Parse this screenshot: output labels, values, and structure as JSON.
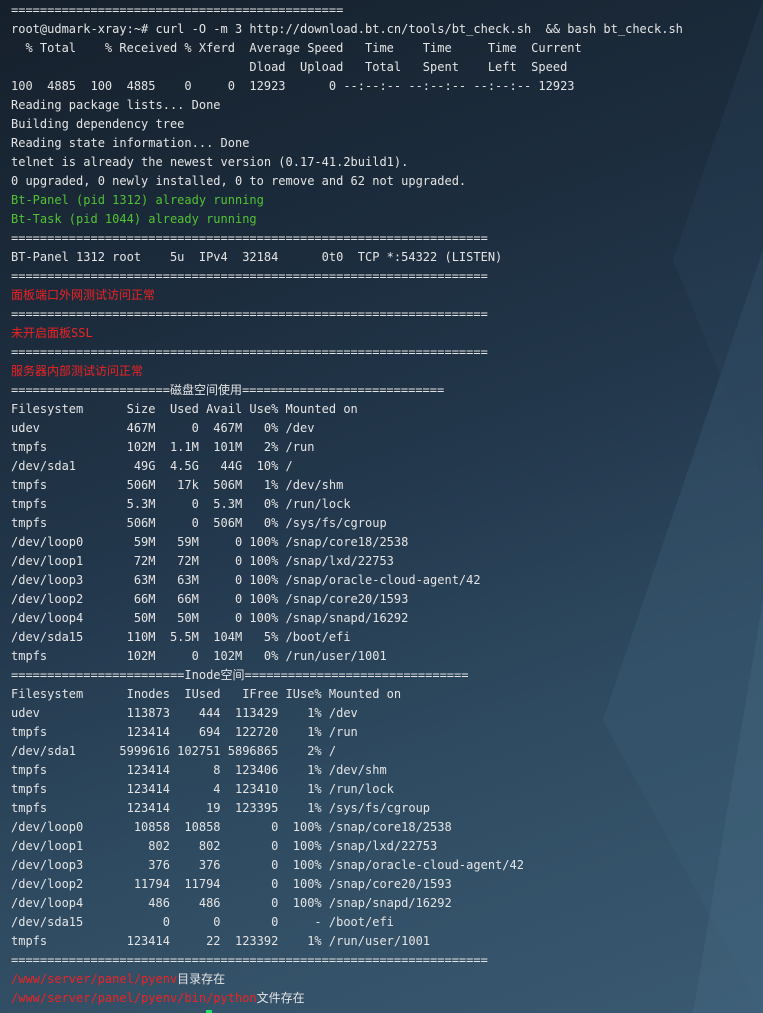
{
  "terminal": {
    "title": "",
    "lines": [
      {
        "text": "==============================================",
        "color": "white"
      },
      {
        "text": "root@udmark-xray:~# curl -O -m 3 http://download.bt.cn/tools/bt_check.sh  && bash bt_check.sh",
        "color": "white"
      },
      {
        "text": "  % Total    % Received % Xferd  Average Speed   Time    Time     Time  Current",
        "color": "white"
      },
      {
        "text": "                                 Dload  Upload   Total   Spent    Left  Speed",
        "color": "white"
      },
      {
        "text": "100  4885  100  4885    0     0  12923      0 --:--:-- --:--:-- --:--:-- 12923",
        "color": "white"
      },
      {
        "text": "Reading package lists... Done",
        "color": "white"
      },
      {
        "text": "Building dependency tree",
        "color": "white"
      },
      {
        "text": "Reading state information... Done",
        "color": "white"
      },
      {
        "text": "telnet is already the newest version (0.17-41.2build1).",
        "color": "white"
      },
      {
        "text": "0 upgraded, 0 newly installed, 0 to remove and 62 not upgraded.",
        "color": "white"
      },
      {
        "text": "Bt-Panel (pid 1312) already running",
        "color": "green"
      },
      {
        "text": "Bt-Task (pid 1044) already running",
        "color": "green"
      },
      {
        "text": "==================================================================",
        "color": "white"
      },
      {
        "text": "BT-Panel 1312 root    5u  IPv4  32184      0t0  TCP *:54322 (LISTEN)",
        "color": "white"
      },
      {
        "text": "==================================================================",
        "color": "white"
      },
      {
        "text": "面板端口外网测试访问正常",
        "color": "red"
      },
      {
        "text": "==================================================================",
        "color": "white"
      },
      {
        "text": "未开启面板SSL",
        "color": "red"
      },
      {
        "text": "==================================================================",
        "color": "white"
      },
      {
        "text": "服务器内部测试访问正常",
        "color": "red"
      },
      {
        "text": "======================磁盘空间使用============================",
        "color": "white"
      },
      {
        "text": "Filesystem      Size  Used Avail Use% Mounted on",
        "color": "white"
      },
      {
        "text": "udev            467M     0  467M   0% /dev",
        "color": "white"
      },
      {
        "text": "tmpfs           102M  1.1M  101M   2% /run",
        "color": "white"
      },
      {
        "text": "/dev/sda1        49G  4.5G   44G  10% /",
        "color": "white"
      },
      {
        "text": "tmpfs           506M   17k  506M   1% /dev/shm",
        "color": "white"
      },
      {
        "text": "tmpfs           5.3M     0  5.3M   0% /run/lock",
        "color": "white"
      },
      {
        "text": "tmpfs           506M     0  506M   0% /sys/fs/cgroup",
        "color": "white"
      },
      {
        "text": "/dev/loop0       59M   59M     0 100% /snap/core18/2538",
        "color": "white"
      },
      {
        "text": "/dev/loop1       72M   72M     0 100% /snap/lxd/22753",
        "color": "white"
      },
      {
        "text": "/dev/loop3       63M   63M     0 100% /snap/oracle-cloud-agent/42",
        "color": "white"
      },
      {
        "text": "/dev/loop2       66M   66M     0 100% /snap/core20/1593",
        "color": "white"
      },
      {
        "text": "/dev/loop4       50M   50M     0 100% /snap/snapd/16292",
        "color": "white"
      },
      {
        "text": "/dev/sda15      110M  5.5M  104M   5% /boot/efi",
        "color": "white"
      },
      {
        "text": "tmpfs           102M     0  102M   0% /run/user/1001",
        "color": "white"
      },
      {
        "text": "========================Inode空间===============================",
        "color": "white"
      },
      {
        "text": "Filesystem      Inodes  IUsed   IFree IUse% Mounted on",
        "color": "white"
      },
      {
        "text": "udev            113873    444  113429    1% /dev",
        "color": "white"
      },
      {
        "text": "tmpfs           123414    694  122720    1% /run",
        "color": "white"
      },
      {
        "text": "/dev/sda1      5999616 102751 5896865    2% /",
        "color": "white"
      },
      {
        "text": "tmpfs           123414      8  123406    1% /dev/shm",
        "color": "white"
      },
      {
        "text": "tmpfs           123414      4  123410    1% /run/lock",
        "color": "white"
      },
      {
        "text": "tmpfs           123414     19  123395    1% /sys/fs/cgroup",
        "color": "white"
      },
      {
        "text": "/dev/loop0       10858  10858       0  100% /snap/core18/2538",
        "color": "white"
      },
      {
        "text": "/dev/loop1         802    802       0  100% /snap/lxd/22753",
        "color": "white"
      },
      {
        "text": "/dev/loop3         376    376       0  100% /snap/oracle-cloud-agent/42",
        "color": "white"
      },
      {
        "text": "/dev/loop2       11794  11794       0  100% /snap/core20/1593",
        "color": "white"
      },
      {
        "text": "/dev/loop4         486    486       0  100% /snap/snapd/16292",
        "color": "white"
      },
      {
        "text": "/dev/sda15           0      0       0     - /boot/efi",
        "color": "white"
      },
      {
        "text": "tmpfs           123414     22  123392    1% /run/user/1001",
        "color": "white"
      },
      {
        "text": "==================================================================",
        "color": "white"
      },
      {
        "segments": [
          {
            "text": "/www/server/panel/pyenv",
            "color": "red"
          },
          {
            "text": "目录存在",
            "color": "white"
          }
        ]
      },
      {
        "segments": [
          {
            "text": "/www/server/panel/pyenv/bin/python",
            "color": "red"
          },
          {
            "text": "文件存在",
            "color": "white"
          }
        ]
      }
    ],
    "cursor_color": "#22e06a",
    "colors": {
      "background": "#1c2d3e",
      "text": "#dedede",
      "green": "#52c233",
      "red": "#ee2222"
    }
  }
}
